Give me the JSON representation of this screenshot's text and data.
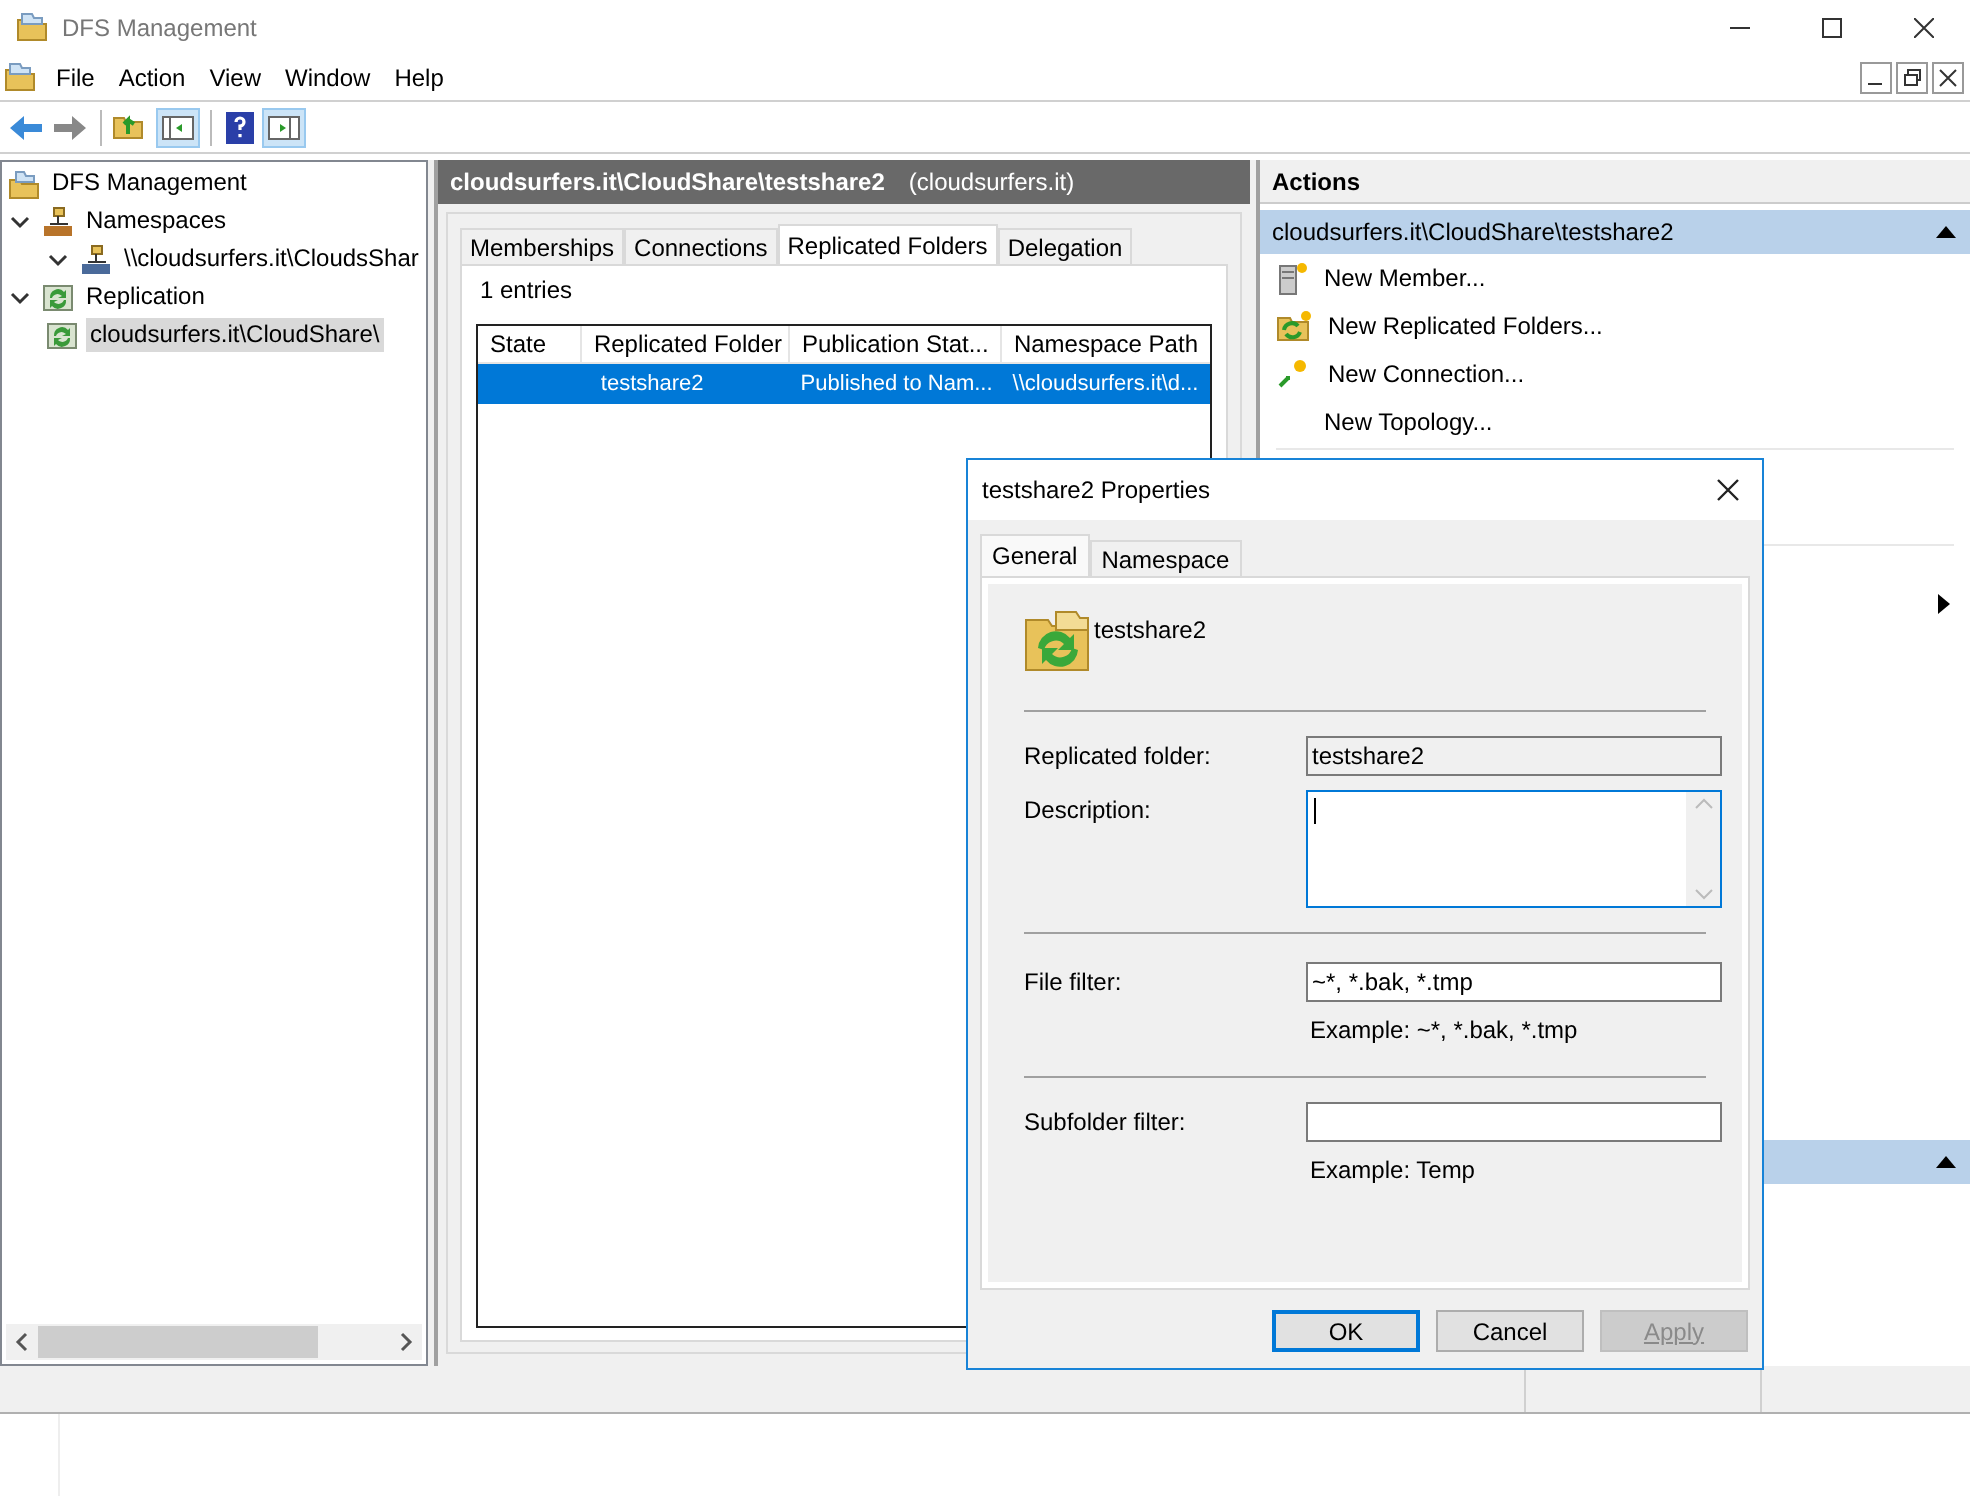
{
  "window": {
    "title": "DFS Management"
  },
  "menu": [
    "File",
    "Action",
    "View",
    "Window",
    "Help"
  ],
  "tree": [
    {
      "label": "DFS Management",
      "kind": "root",
      "selected": false,
      "children": [
        {
          "label": "Namespaces",
          "kind": "namespaces",
          "expanded": true,
          "selected": false,
          "children": [
            {
              "label": "\\\\cloudsurfers.it\\CloudsShar",
              "kind": "namespace",
              "expanded": true,
              "selected": false
            }
          ]
        },
        {
          "label": "Replication",
          "kind": "replication",
          "expanded": true,
          "selected": false,
          "children": [
            {
              "label": "cloudsurfers.it\\CloudShare\\",
              "kind": "group",
              "selected": true
            }
          ]
        }
      ]
    }
  ],
  "details": {
    "title": "cloudsurfers.it\\CloudShare\\testshare2",
    "subtitle": "(cloudsurfers.it)",
    "tabs": [
      {
        "label": "Memberships",
        "selected": false
      },
      {
        "label": "Connections",
        "selected": false
      },
      {
        "label": "Replicated Folders",
        "selected": true
      },
      {
        "label": "Delegation",
        "selected": false
      }
    ],
    "count": "1 entries",
    "columns": [
      "State",
      "Replicated Folder",
      "Publication Stat...",
      "Namespace Path"
    ],
    "rows": [
      {
        "cells": [
          "",
          "testshare2",
          "Published to Nam...",
          "\\\\cloudsurfers.it\\d..."
        ],
        "selected": true
      }
    ]
  },
  "actions": {
    "title": "Actions",
    "groups": [
      {
        "title": "cloudsurfers.it\\CloudShare\\testshare2",
        "expanded": true,
        "items": [
          {
            "label": "New Member...",
            "kind": "member"
          },
          {
            "label": "New Replicated Folders...",
            "kind": "folders"
          },
          {
            "label": "New Connection...",
            "kind": "connection"
          },
          {
            "label": "New Topology...",
            "kind": "none"
          }
        ]
      },
      {
        "expanded": true
      }
    ]
  },
  "dialog": {
    "title": "testshare2 Properties",
    "tabs": [
      {
        "label": "General",
        "selected": true
      },
      {
        "label": "Namespace",
        "selected": false
      }
    ],
    "name": "testshare2",
    "fields": [
      {
        "label": "Replicated folder:",
        "kind": "readonly",
        "value": "testshare2"
      },
      {
        "label": "Description:",
        "kind": "multiline",
        "focused": true
      },
      {
        "label": "File filter:",
        "kind": "text",
        "value": "~*, *.bak, *.tmp",
        "example": "Example: ~*, *.bak, *.tmp",
        "divider": true
      },
      {
        "label": "Subfolder filter:",
        "kind": "text",
        "example": "Example: Temp",
        "divider": true
      }
    ],
    "buttons": [
      {
        "label": "OK",
        "default": true,
        "disabled": false
      },
      {
        "label": "Cancel",
        "default": false,
        "disabled": false
      },
      {
        "label": "Apply",
        "default": false,
        "disabled": true
      }
    ]
  }
}
